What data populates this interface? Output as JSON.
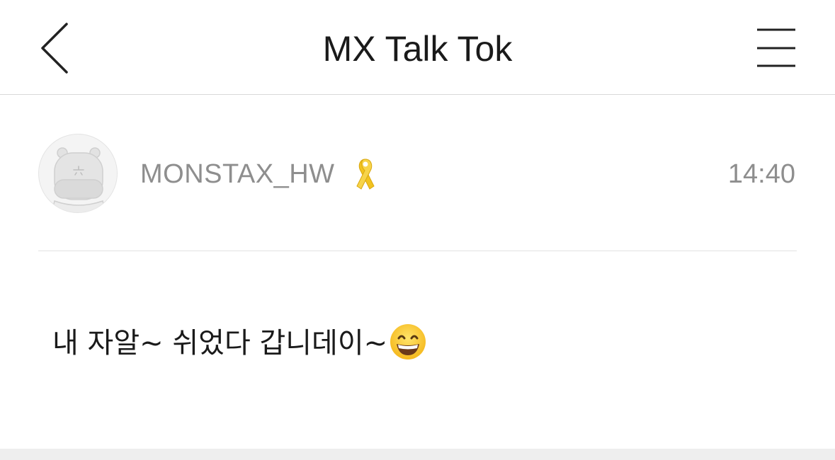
{
  "header": {
    "title": "MX Talk Tok",
    "back_icon": "chevron-left-icon",
    "menu_icon": "hamburger-menu-icon"
  },
  "post": {
    "username": "MONSTAX_HW",
    "badge_icon": "yellow-ribbon-icon",
    "time": "14:40",
    "avatar_icon": "hippo-avatar",
    "message": "내 자알~ 쉬었다 갑니데이~",
    "message_emoji": "grinning-face-emoji"
  },
  "colors": {
    "title_text": "#1a1a1a",
    "meta_text": "#8e8e8e",
    "divider": "#e2e2e2",
    "ribbon": "#f2c31f",
    "footer": "#eeeeee"
  }
}
